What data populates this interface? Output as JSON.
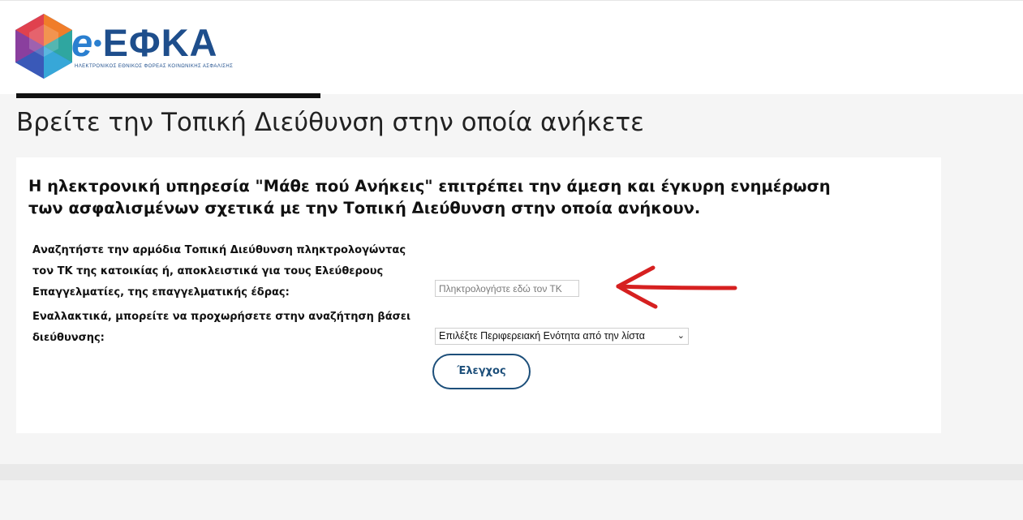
{
  "header": {
    "logo_text_e": "e",
    "logo_text_main": "ΕΦΚΑ",
    "logo_subtitle": "ΗΛΕΚΤΡΟΝΙΚΟΣ ΕΘΝΙΚΟΣ ΦΟΡΕΑΣ ΚΟΙΝΩΝΙΚΗΣ ΑΣΦΑΛΙΣΗΣ"
  },
  "page": {
    "title": "Βρείτε την Τοπική Διεύθυνση στην οποία ανήκετε"
  },
  "card": {
    "intro": "Η ηλεκτρονική υπηρεσία \"Μάθε πού Ανήκεις\" επιτρέπει την άμεση και έγκυρη ενημέρωση των ασφαλισμένων σχετικά με την Τοπική Διεύθυνση στην οποία ανήκουν.",
    "zip_label": "Αναζητήστε την αρμόδια Τοπική Διεύθυνση πληκτρολογώντας τον ΤΚ της κατοικίας ή, αποκλειστικά για τους Ελεύθερους Επαγγελματίες, της επαγγελματικής έδρας:",
    "zip_placeholder": "Πληκτρολογήστε εδώ τον ΤΚ",
    "zip_value": "",
    "alt_label": "Εναλλακτικά, μπορείτε να προχωρήσετε στην αναζήτηση βάσει διεύθυνσης:",
    "region_selected": "Επιλέξτε Περιφερειακή Ενότητα από την λίστα",
    "check_button": "Έλεγχος"
  },
  "icons": {
    "dropdown": "chevron-down-icon",
    "annotation": "red-arrow-icon"
  },
  "colors": {
    "brand_blue": "#1e4e8c",
    "button_border": "#1d4f7a",
    "arrow": "#d62020"
  }
}
